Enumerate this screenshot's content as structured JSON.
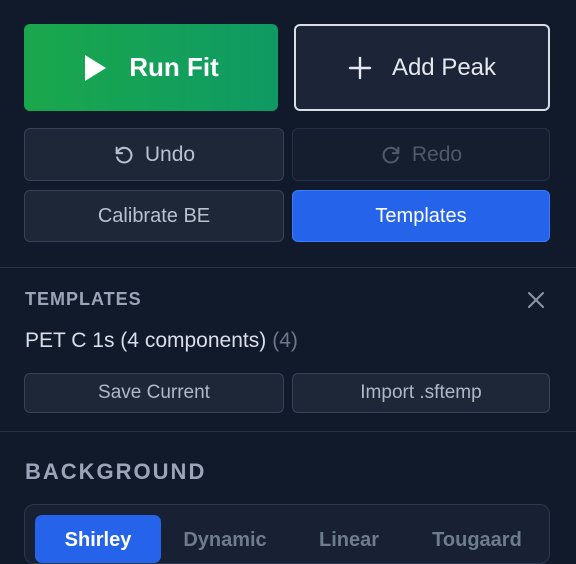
{
  "actions": {
    "run_fit": "Run Fit",
    "add_peak": "Add Peak",
    "undo": "Undo",
    "redo": "Redo",
    "calibrate": "Calibrate BE",
    "templates": "Templates"
  },
  "templates_panel": {
    "title": "TEMPLATES",
    "template_name": "PET C 1s (4 components)",
    "template_count": "(4)",
    "save_current": "Save Current",
    "import": "Import .sftemp"
  },
  "background": {
    "title": "BACKGROUND",
    "options": [
      "Shirley",
      "Dynamic",
      "Linear",
      "Tougaard"
    ],
    "selected": "Shirley"
  },
  "colors": {
    "run_fit_start": "#1aa74c",
    "run_fit_end": "#0f9a64",
    "accent": "#2563eb",
    "panel_bg": "#111a2b"
  },
  "icons": {
    "run_fit": "play-icon",
    "add_peak": "plus-icon",
    "undo": "undo-icon",
    "redo": "redo-icon",
    "close": "close-icon"
  }
}
